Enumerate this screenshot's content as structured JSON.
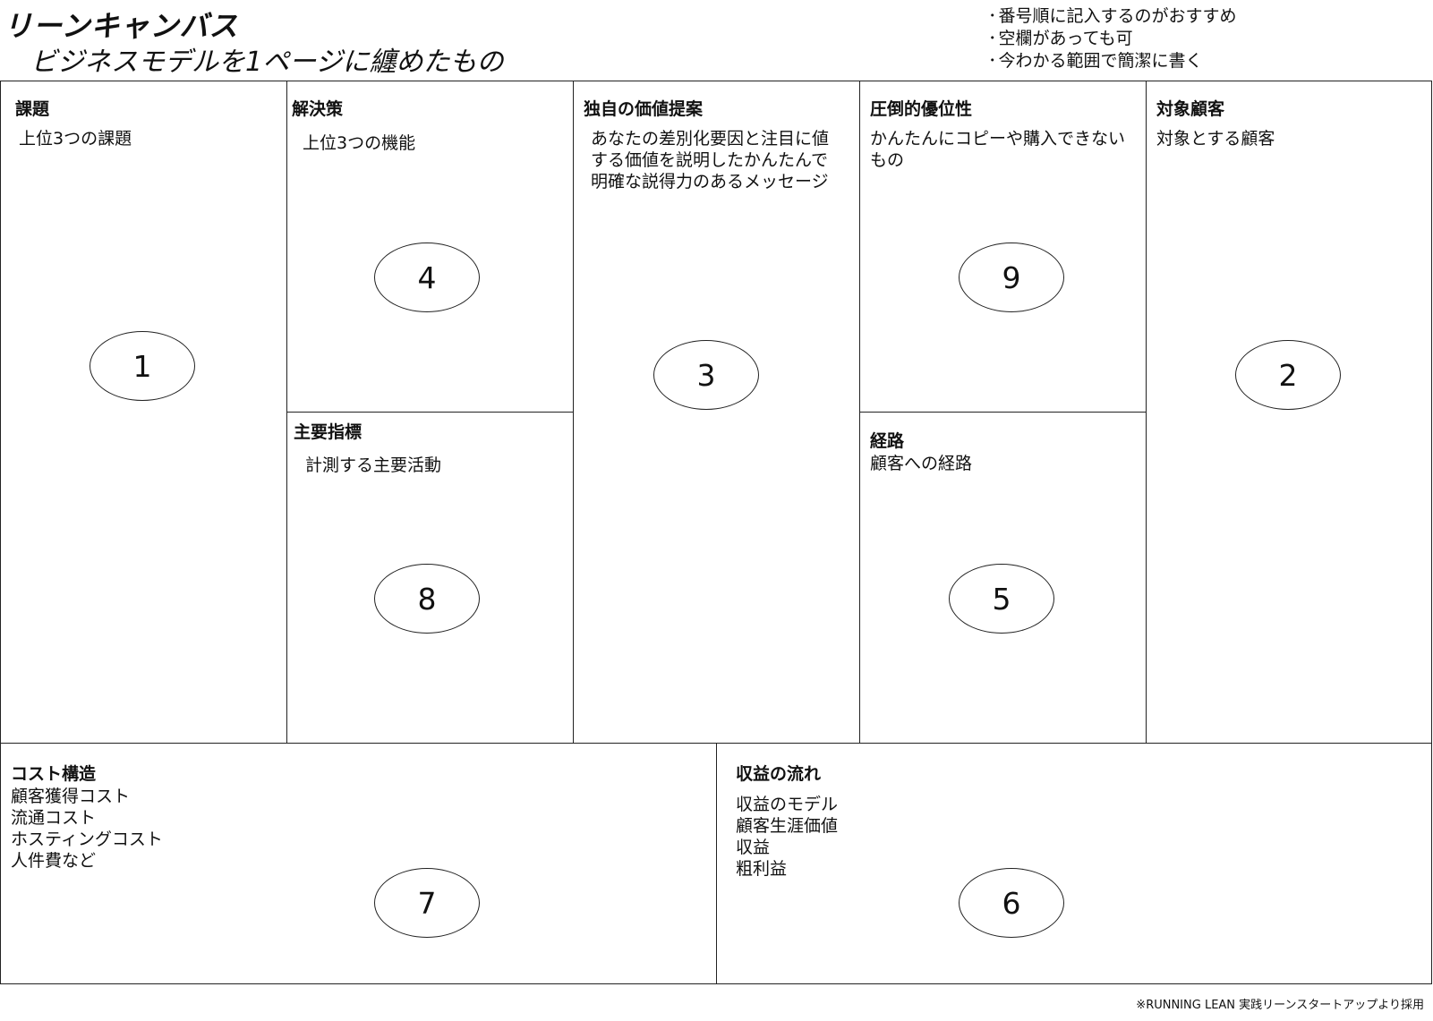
{
  "header": {
    "title": "リーンキャンバス",
    "subtitle": "ビジネスモデルを1ページに纏めたもの"
  },
  "notes": [
    "番号順に記入するのがおすすめ",
    "空欄があっても可",
    "今わかる範囲で簡潔に書く"
  ],
  "blocks": {
    "problem": {
      "title": "課題",
      "text": "上位3つの課題",
      "number": "1"
    },
    "solution": {
      "title": "解決策",
      "text": "上位3つの機能",
      "number": "4"
    },
    "key_metrics": {
      "title": "主要指標",
      "text": "計測する主要活動",
      "number": "8"
    },
    "uvp": {
      "title": "独自の価値提案",
      "text": "あなたの差別化要因と注目に値\nする価値を説明したかんたんで\n明確な説得力のあるメッセージ",
      "number": "3"
    },
    "unfair_advantage": {
      "title": "圧倒的優位性",
      "text": "かんたんにコピーや購入できない\nもの",
      "number": "9"
    },
    "channels": {
      "title": "経路",
      "text": "顧客への経路",
      "number": "5"
    },
    "customer_segments": {
      "title": "対象顧客",
      "text": "対象とする顧客",
      "number": "2"
    },
    "cost_structure": {
      "title": "コスト構造",
      "text": "顧客獲得コスト\n流通コスト\nホスティングコスト\n人件費など",
      "number": "7"
    },
    "revenue_streams": {
      "title": "収益の流れ",
      "text": "収益のモデル\n顧客生涯価値\n収益\n粗利益",
      "number": "6"
    }
  },
  "footer": "※RUNNING LEAN 実践リーンスタートアップより採用"
}
